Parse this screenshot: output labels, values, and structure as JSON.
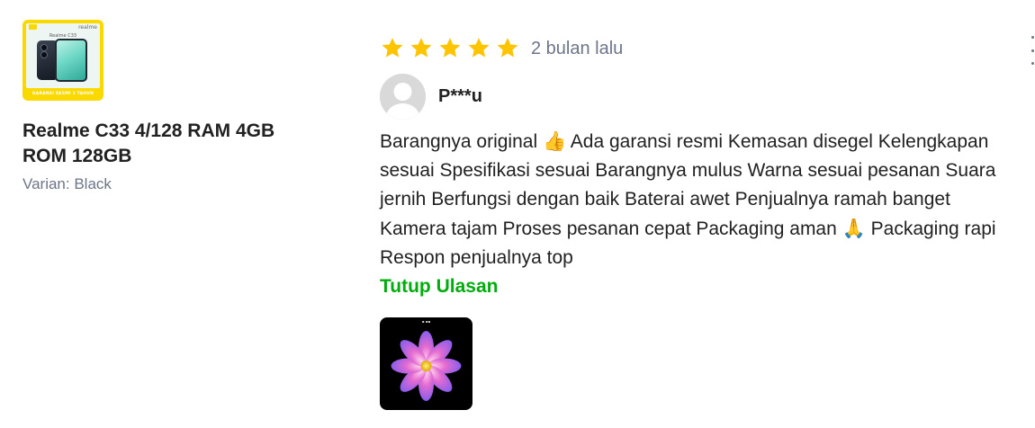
{
  "product": {
    "image_icon": "product-image",
    "thumb_brand": "realme",
    "thumb_model": "Realme C33",
    "thumb_banner": "GARANSI RESMI 1 TAHUN",
    "name": "Realme C33 4/128 RAM 4GB ROM 128GB",
    "variant": "Varian: Black"
  },
  "review": {
    "rating": 5,
    "rating_max": 5,
    "star_color": "#ffc400",
    "time": "2 bulan lalu",
    "reviewer_name": "P***u",
    "text_part1": "Barangnya original ",
    "emoji1": "👍",
    "text_part2": " Ada garansi resmi Kemasan disegel Kelengkapan sesuai Spesifikasi sesuai Barangnya mulus Warna sesuai pesanan Suara jernih Berfungsi dengan baik Baterai awet Penjualnya ramah banget Kamera tajam Proses pesanan cepat Packaging aman ",
    "emoji2": "🙏",
    "text_part3": " Packaging rapi Respon penjualnya top",
    "close_label": "Tutup Ulasan",
    "close_color": "#03ac0e",
    "photo_icon": "flower-photo"
  },
  "menu": {
    "icon": "kebab-menu-icon"
  }
}
